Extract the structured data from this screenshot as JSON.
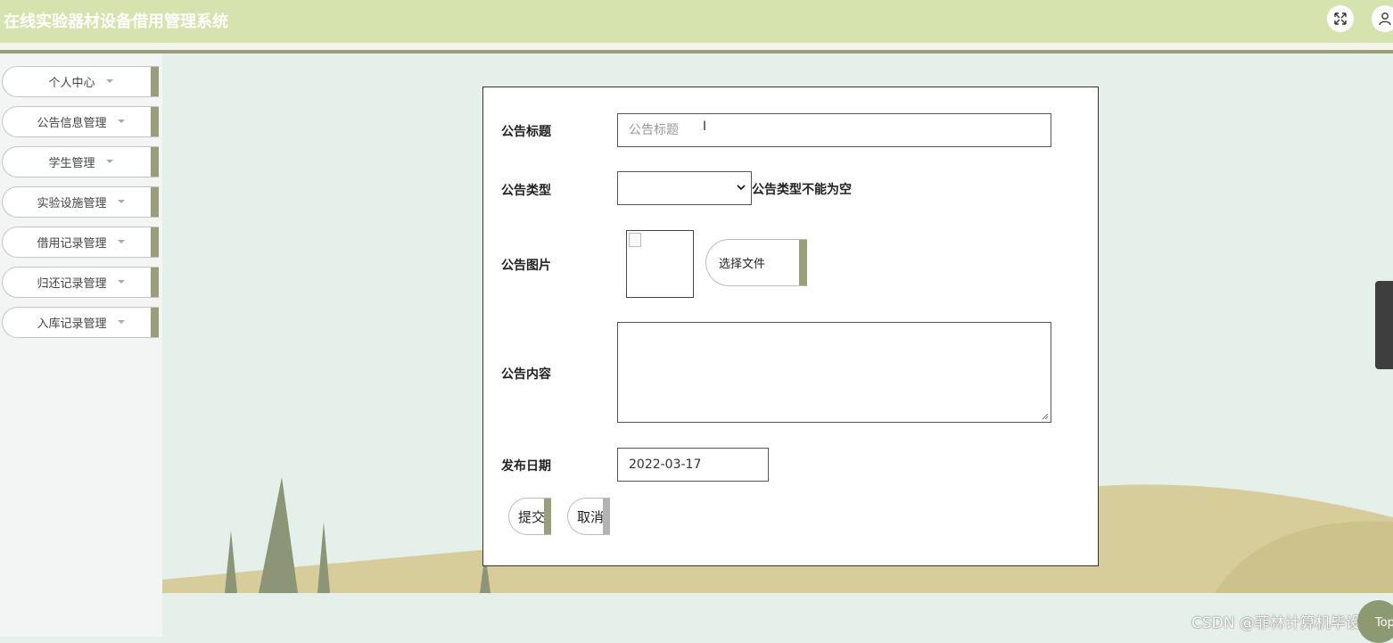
{
  "app": {
    "title": "在线实验器材设备借用管理系统"
  },
  "header": {
    "fullscreen_icon": "expand-icon",
    "user_icon": "user-icon"
  },
  "sidebar": {
    "items": [
      {
        "label": "个人中心"
      },
      {
        "label": "公告信息管理"
      },
      {
        "label": "学生管理"
      },
      {
        "label": "实验设施管理"
      },
      {
        "label": "借用记录管理"
      },
      {
        "label": "归还记录管理"
      },
      {
        "label": "入库记录管理"
      }
    ]
  },
  "form": {
    "title_label": "公告标题",
    "title_placeholder": "公告标题",
    "title_value": "",
    "type_label": "公告类型",
    "type_value": "",
    "type_error": "公告类型不能为空",
    "image_label": "公告图片",
    "file_button": "选择文件",
    "content_label": "公告内容",
    "content_value": "",
    "date_label": "发布日期",
    "date_value": "2022-03-17",
    "submit_label": "提交",
    "cancel_label": "取消"
  },
  "footer": {
    "watermark": "CSDN @菲林计算机毕设",
    "top_button": "Top"
  },
  "colors": {
    "header_bg": "#d5e4ae",
    "accent": "#9a9e7a",
    "page_bg": "#e6f0ea"
  }
}
